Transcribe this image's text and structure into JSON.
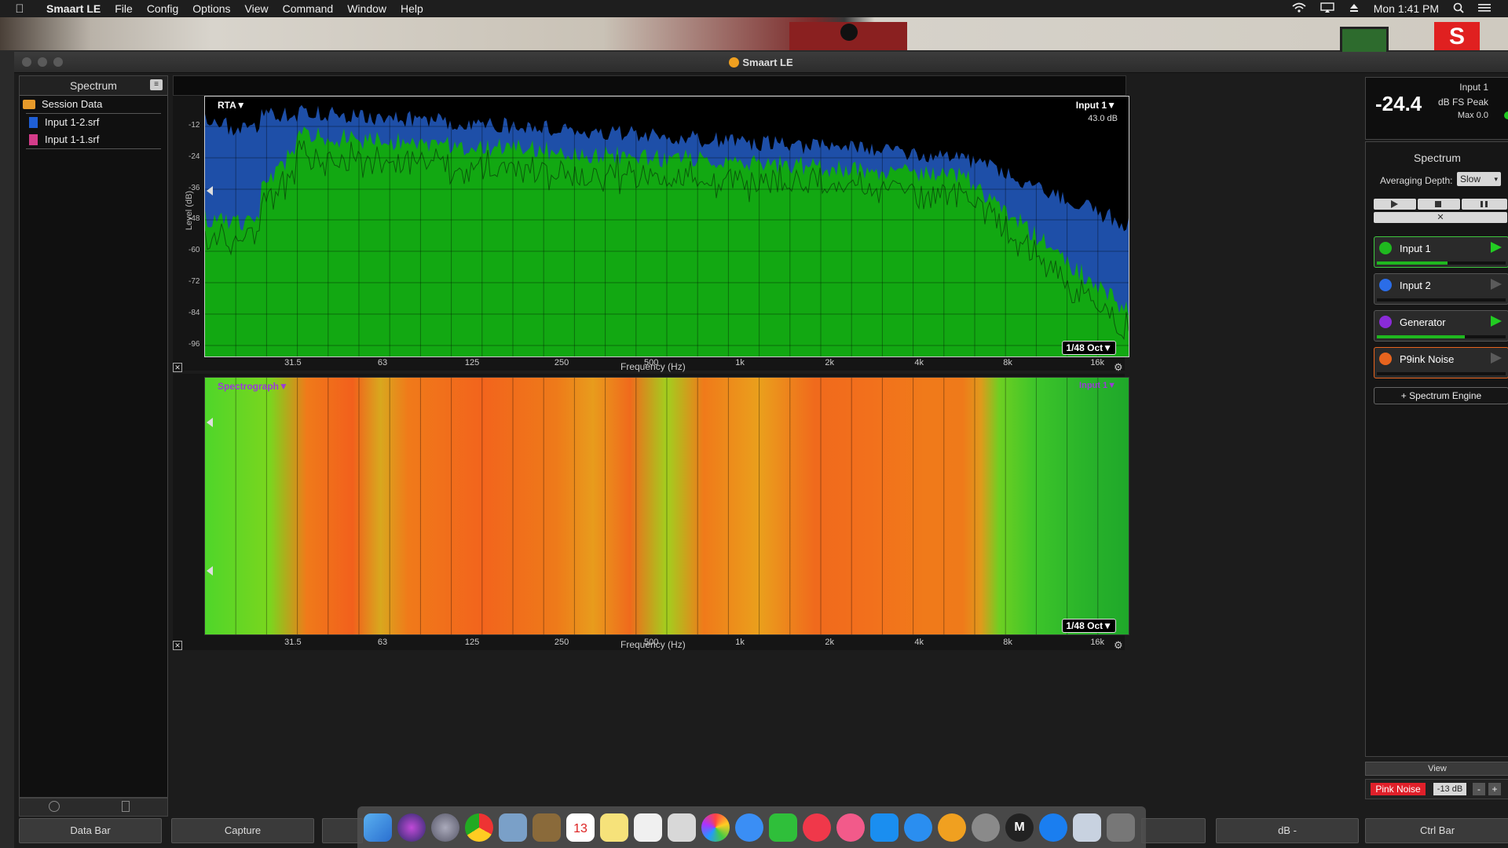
{
  "menubar": {
    "items": [
      "Smaart LE",
      "File",
      "Config",
      "Options",
      "View",
      "Command",
      "Window",
      "Help"
    ],
    "clock": "Mon 1:41 PM"
  },
  "window": {
    "title": "Smaart LE"
  },
  "left_panel": {
    "header": "Spectrum",
    "folder": "Session Data",
    "files": [
      "Input 1-2.srf",
      "Input 1-1.srf"
    ],
    "file_colors": [
      "#1f5fd6",
      "#d43c8a"
    ]
  },
  "rta": {
    "mode_label": "RTA▼",
    "input_label": "Input 1▼",
    "db_readout": "43.0 dB",
    "octave_label": "1/48 Oct▼",
    "y_axis_label": "Level (dB)",
    "y_ticks": [
      "-12",
      "-24",
      "-36",
      "-48",
      "-60",
      "-72",
      "-84",
      "-96"
    ],
    "x_axis_label": "Frequency (Hz)",
    "x_ticks": [
      "31.5",
      "63",
      "125",
      "250",
      "500",
      "1k",
      "2k",
      "4k",
      "8k",
      "16k"
    ]
  },
  "spectrograph": {
    "mode_label": "Spectrograph▼",
    "input_label": "Input 1▼",
    "octave_label": "1/48 Oct▼",
    "x_axis_label": "Frequency (Hz)",
    "x_ticks": [
      "31.5",
      "63",
      "125",
      "250",
      "500",
      "1k",
      "2k",
      "4k",
      "8k",
      "16k"
    ]
  },
  "meter": {
    "value": "-24.4",
    "input": "Input 1",
    "unit": "dB FS Peak",
    "max": "Max 0.0"
  },
  "right_panel": {
    "title": "Spectrum",
    "averaging_label": "Averaging Depth:",
    "averaging_value": "Slow",
    "engines": [
      {
        "name": "Input 1",
        "color": "#1fb81f",
        "play_color": "#22cc22",
        "level": 0.55
      },
      {
        "name": "Input 2",
        "color": "#2b6de8",
        "play_color": "#5a5a5a",
        "level": 0.0
      },
      {
        "name": "Generator",
        "color": "#8a2bd8",
        "play_color": "#22cc22",
        "level": 0.68
      },
      {
        "name": "P9ink Noise",
        "color": "#e8641e",
        "play_color": "#5a5a5a",
        "level": 0.0
      }
    ],
    "add_engine": "+ Spectrum Engine",
    "view_label": "View"
  },
  "generator_bar": {
    "pink_noise": "Pink Noise",
    "level": "-13 dB",
    "minus": "-",
    "plus": "+"
  },
  "bottom_buttons": [
    "Data Bar",
    "Capture",
    "dB -",
    "Ctrl Bar"
  ],
  "dock": {
    "calendar_day": "13"
  }
}
